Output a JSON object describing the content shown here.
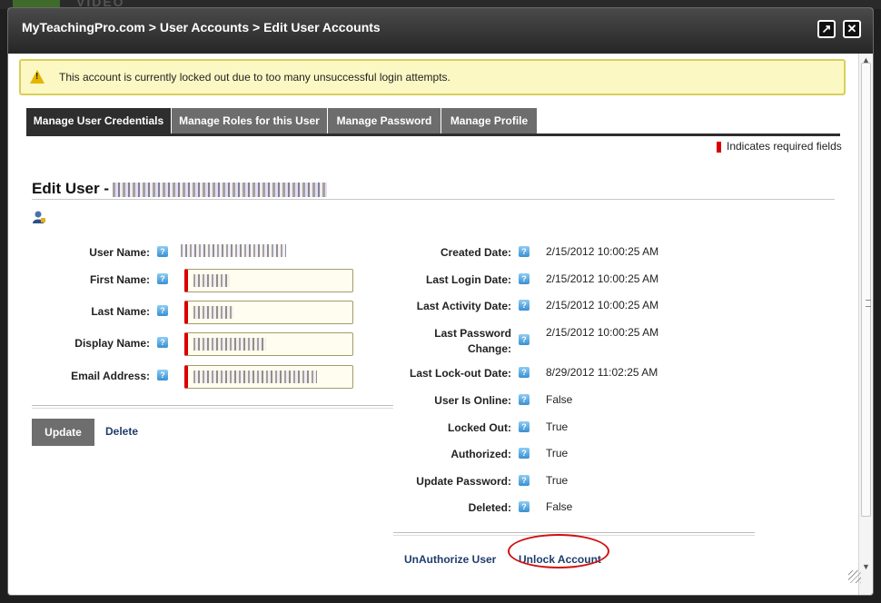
{
  "window": {
    "title": "MyTeachingPro.com > User Accounts > Edit User Accounts",
    "expand_icon": "↗",
    "close_icon": "✕"
  },
  "alert": {
    "message": "This account is currently locked out due to too many unsuccessful login attempts."
  },
  "tabs": [
    {
      "label": "Manage User Credentials",
      "active": true
    },
    {
      "label": "Manage Roles for this User",
      "active": false
    },
    {
      "label": "Manage Password",
      "active": false
    },
    {
      "label": "Manage Profile",
      "active": false
    }
  ],
  "required_note": "Indicates required fields",
  "edit_title": "Edit User -",
  "left_fields": [
    {
      "label": "User Name:"
    },
    {
      "label": "First Name:"
    },
    {
      "label": "Last Name:"
    },
    {
      "label": "Display Name:"
    },
    {
      "label": "Email Address:"
    }
  ],
  "right_fields": [
    {
      "label": "Created Date:",
      "value": "2/15/2012 10:00:25 AM"
    },
    {
      "label": "Last Login Date:",
      "value": "2/15/2012 10:00:25 AM"
    },
    {
      "label": "Last Activity Date:",
      "value": "2/15/2012 10:00:25 AM"
    },
    {
      "label": "Last Password",
      "label2": "Change:",
      "value": "2/15/2012 10:00:25 AM"
    },
    {
      "label": "Last Lock-out Date:",
      "value": "8/29/2012 11:02:25 AM"
    },
    {
      "label": "User Is Online:",
      "value": "False"
    },
    {
      "label": "Locked Out:",
      "value": "True"
    },
    {
      "label": "Authorized:",
      "value": "True"
    },
    {
      "label": "Update Password:",
      "value": "True"
    },
    {
      "label": "Deleted:",
      "value": "False"
    }
  ],
  "help_icon_glyph": "?",
  "actions": {
    "update": "Update",
    "delete": "Delete",
    "unauthorize": "UnAuthorize User",
    "unlock": "Unlock Account"
  },
  "background": {
    "text": "VIDEO"
  },
  "colors": {
    "required": "#d90000",
    "link": "#1f3d6b",
    "alert_bg": "#fbf8c4"
  }
}
